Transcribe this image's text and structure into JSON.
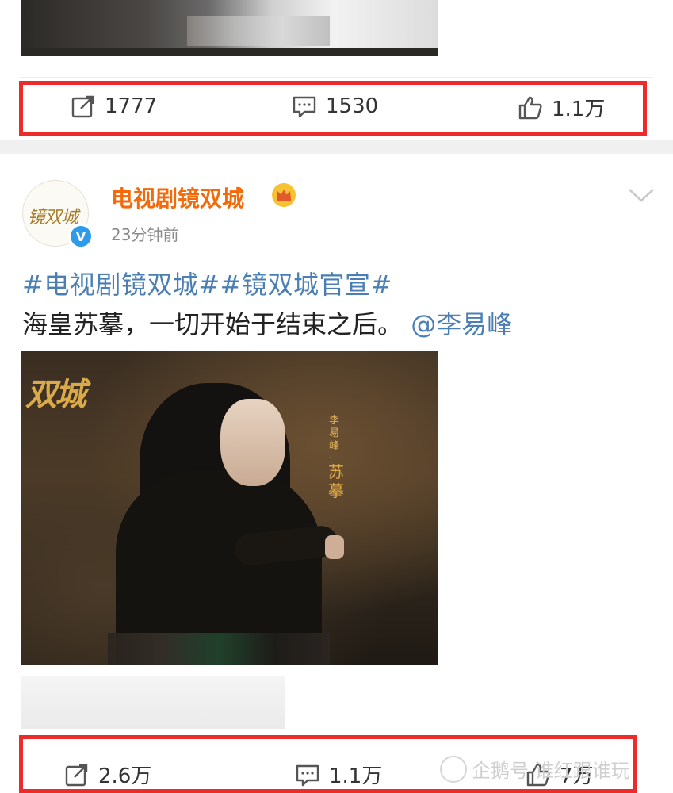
{
  "post1": {
    "actions": {
      "repost_count": "1777",
      "comment_count": "1530",
      "like_count": "1.1万"
    }
  },
  "post2": {
    "author_name": "电视剧镜双城",
    "avatar_logo_text": "镜双城",
    "verified_mark": "V",
    "timestamp": "23分钟前",
    "topics": "#电视剧镜双城##镜双城官宣#",
    "text_main": "海皇苏摹，一切开始于结束之后。",
    "mention": "@李易峰",
    "image": {
      "title_art": "双城",
      "caption_small": "李易峰·",
      "caption_large": "苏摹"
    },
    "actions": {
      "repost_count": "2.6万",
      "comment_count": "1.1万",
      "like_count": "7万"
    }
  },
  "watermark": "企鹅号 谁红跟谁玩",
  "colors": {
    "author_name": "#f46a0a",
    "link": "#4b7fb3",
    "highlight_box": "#ee2b2b",
    "verified": "#2e9bea"
  },
  "icons": [
    "repost-icon",
    "comment-icon",
    "like-icon",
    "crown-icon",
    "chevron-down-icon",
    "verified-icon"
  ]
}
